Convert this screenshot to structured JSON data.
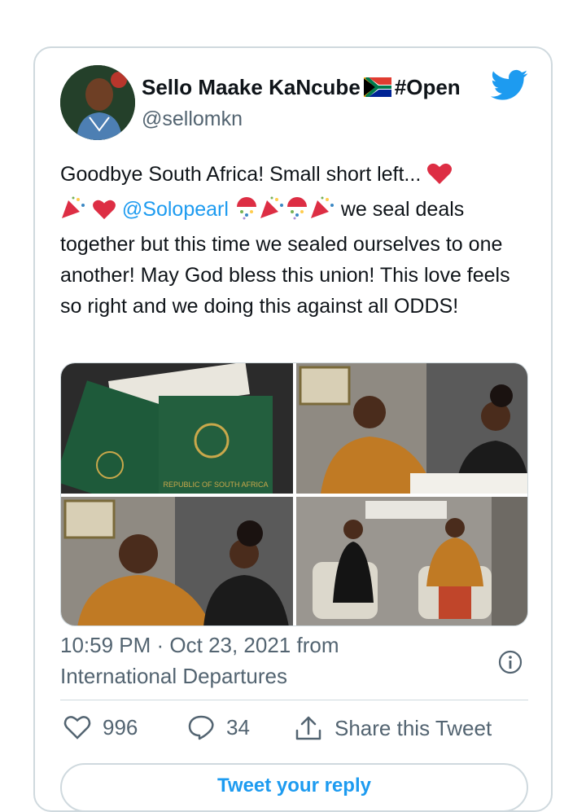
{
  "tweet": {
    "author": {
      "name": "Sello Maake KaNcube",
      "name_suffix": "#Open",
      "handle": "@sellomkn",
      "flag_icon": "south-africa-flag-icon",
      "avatar_icon": "avatar"
    },
    "text": {
      "line1": "Goodbye South Africa! Small short left... ",
      "mention": "@Solopearl",
      "after_mention": " we seal deals",
      "rest": "together but this time we sealed ourselves to one another! May God bless this union! This love feels so right and we doing this against all ODDS!"
    },
    "media": {
      "photos": [
        "passport-photo",
        "couple-signing-photo-1",
        "couple-signing-photo-2",
        "couple-seated-photo"
      ],
      "passport_text": "REPUBLIC OF SOUTH AFRICA"
    },
    "timestamp": "10:59 PM · Oct 23, 2021 from",
    "location": "International Departures",
    "actions": {
      "likes": "996",
      "replies": "34",
      "share_label": "Share this Tweet"
    },
    "reply_label": "Tweet your reply"
  },
  "colors": {
    "accent": "#1d9bf0",
    "secondary_text": "#536471",
    "border": "#cfd9de",
    "heart": "#e0245e"
  }
}
